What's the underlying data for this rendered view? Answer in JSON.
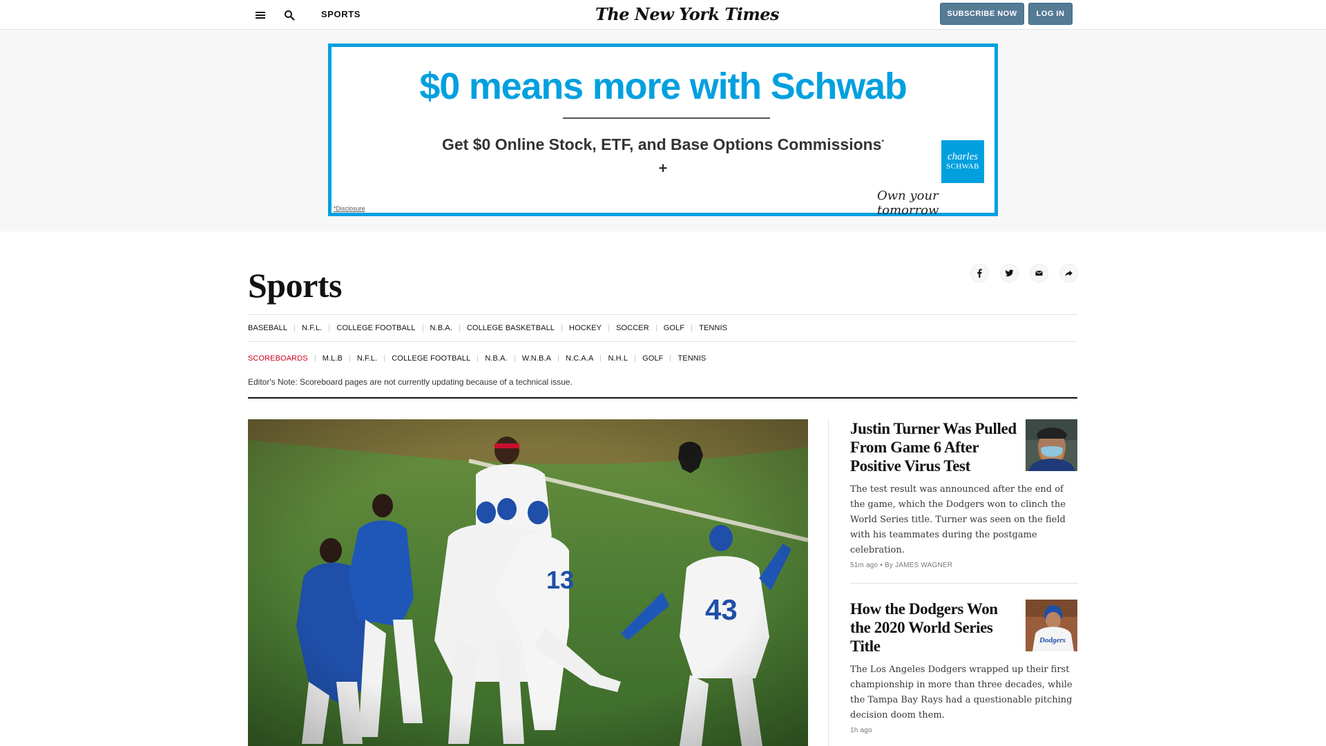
{
  "header": {
    "section_label": "SPORTS",
    "logo_text": "The New York Times",
    "subscribe_label": "SUBSCRIBE NOW",
    "login_label": "LOG IN"
  },
  "ad": {
    "headline": "$0 means more with Schwab",
    "subline": "Get $0 Online Stock, ETF, and Base Options Commissions",
    "subline_mark": "*",
    "plus": "+",
    "logo_line1": "charles",
    "logo_line2": "SCHWAB",
    "tagline": "Own your tomorrow",
    "disclosure": "*Disclosure",
    "brand_color": "#00a0df"
  },
  "page": {
    "title": "Sports",
    "share_icons": [
      "facebook-icon",
      "twitter-icon",
      "email-icon",
      "share-icon"
    ],
    "editor_note": "Editor's Note: Scoreboard pages are not currently updating because of a technical issue."
  },
  "nav_primary": [
    "BASEBALL",
    "N.F.L.",
    "COLLEGE FOOTBALL",
    "N.B.A.",
    "COLLEGE BASKETBALL",
    "HOCKEY",
    "SOCCER",
    "GOLF",
    "TENNIS"
  ],
  "nav_scoreboards": [
    "SCOREBOARDS",
    "M.L.B",
    "N.F.L.",
    "COLLEGE FOOTBALL",
    "N.B.A.",
    "W.N.B.A",
    "N.C.A.A",
    "N.H.L",
    "GOLF",
    "TENNIS"
  ],
  "stories": [
    {
      "headline": "Justin Turner Was Pulled From Game 6 After Positive Virus Test",
      "summary": "The test result was announced after the end of the game, which the Dodgers won to clinch the World Series title. Turner was seen on the field with his teammates during the postgame celebration.",
      "time": "51m ago",
      "byline": "By JAMES WAGNER"
    },
    {
      "headline": "How the Dodgers Won the 2020 World Series Title",
      "summary": "The Los Angeles Dodgers wrapped up their first championship in more than three decades, while the Tampa Bay Rays had a questionable pitching decision doom them.",
      "time": "1h ago",
      "byline": ""
    }
  ]
}
